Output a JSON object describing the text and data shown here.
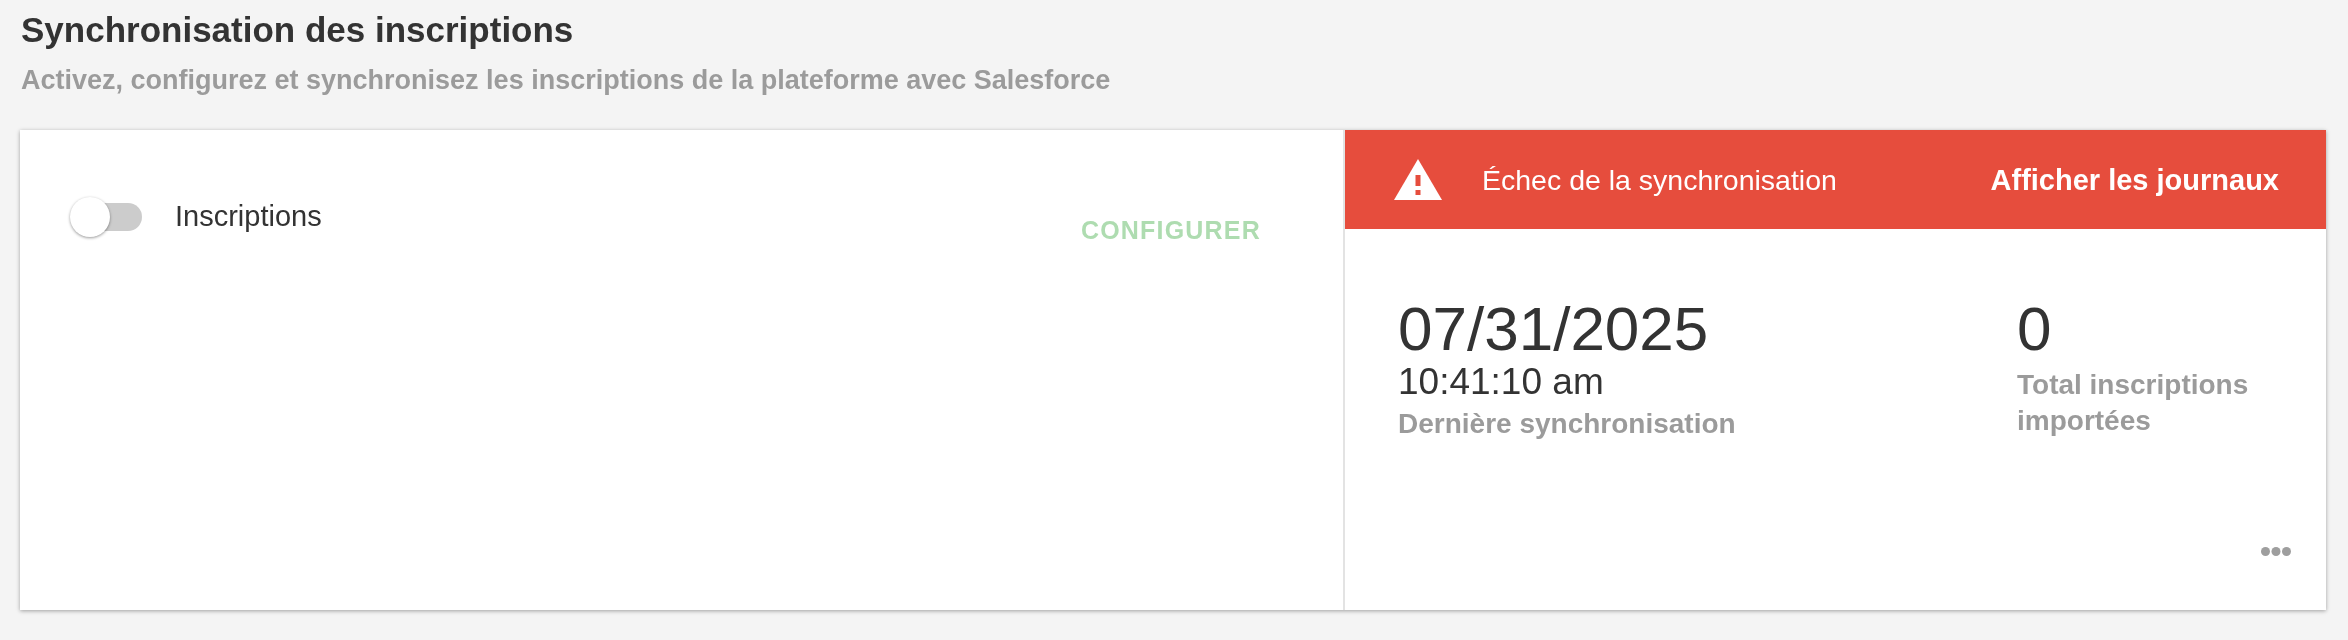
{
  "header": {
    "title": "Synchronisation des inscriptions",
    "subtitle": "Activez, configurez et synchronisez les inscriptions de la plateforme avec Salesforce"
  },
  "integration": {
    "toggle": {
      "label": "Inscriptions",
      "on": false
    },
    "configure_button": {
      "label": "CONFIGURER",
      "disabled": true
    }
  },
  "sync_status": {
    "failed": true,
    "message": "Échec de la synchronisation",
    "logs_link": "Afficher les journaux"
  },
  "last_sync": {
    "date": "07/31/2025",
    "time": "10:41:10 am",
    "label": "Dernière synchronisation"
  },
  "total": {
    "value": "0",
    "label": "Total inscriptions importées"
  }
}
